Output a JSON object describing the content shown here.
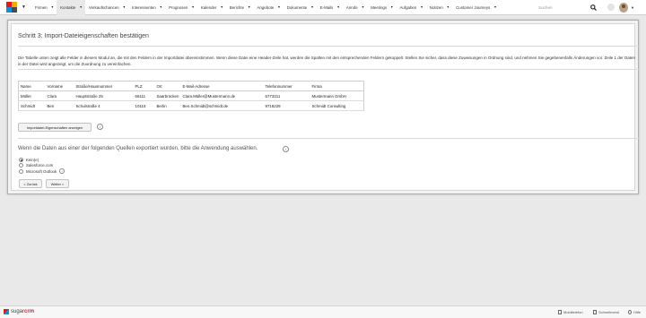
{
  "nav": {
    "items": [
      {
        "label": "Firmen",
        "active": false
      },
      {
        "label": "Kontakte",
        "active": true
      },
      {
        "label": "Verkaufschancen",
        "active": false
      },
      {
        "label": "Interessenten",
        "active": false
      },
      {
        "label": "Prognosen",
        "active": false
      },
      {
        "label": "Kalender",
        "active": false
      },
      {
        "label": "Berichte",
        "active": false
      },
      {
        "label": "Angebote",
        "active": false
      },
      {
        "label": "Dokumente",
        "active": false
      },
      {
        "label": "E-Mails",
        "active": false
      },
      {
        "label": "Anrufe",
        "active": false
      },
      {
        "label": "Meetings",
        "active": false
      },
      {
        "label": "Aufgaben",
        "active": false
      },
      {
        "label": "Notizen",
        "active": false
      },
      {
        "label": "Customer Journeys",
        "active": false
      }
    ],
    "search_placeholder": "Suchen"
  },
  "step": {
    "title": "Schritt 3: Import-Dateieigenschaften bestätigen",
    "description": "Die Tabelle unten zeigt alle Felder in diesem Modul an, die mit den Feldern in der Importdatei übereinstimmen. Wenn diese Datei eine Header-Zeile hat, werden die Spalten mit den entsprechenden Feldern gekoppelt. Stellen Sie sicher, dass diese Zuweisungen in Ordnung sind, und nehmen Sie gegebenenfalls Änderungen vor. Zeile 1 der Daten in der Datei wird angezeigt, um die Zuordnung zu vereinfachen."
  },
  "table": {
    "columns": [
      "Name",
      "Vorname",
      "Straße/Hausnummer",
      "PLZ",
      "Ort",
      "E-Mail-Adresse",
      "Telefonnummer",
      "Firma"
    ],
    "rows": [
      [
        "Müller",
        "Clara",
        "Hauptstraße 25",
        "66111",
        "Saarbrücken",
        "Clara.Müller@Mustermann.de",
        "6773311",
        "Mustermann GmbH"
      ],
      [
        "Schmidt",
        "Ben",
        "Schulstraße 4",
        "10115",
        "Berlin",
        "Ben.Schmidt@schmidt.de",
        "9718229",
        "Schmidt Consulting"
      ]
    ]
  },
  "buttons": {
    "show_props": "Importdatei-Eigenschaften anzeigen",
    "back": "< Zurück",
    "next": "Weiter >"
  },
  "source": {
    "question": "Wenn die Daten aus einer der folgenden Quellen exportiert wurden, bitte die Anwendung auswählen.",
    "options": [
      {
        "label": "Kein(e)",
        "selected": true
      },
      {
        "label": "Salesforce.com",
        "selected": false
      },
      {
        "label": "Microsoft Outlook",
        "selected": false
      }
    ]
  },
  "footer": {
    "brand_a": "sugar",
    "brand_b": "crm",
    "mobile": "Mobiltelefon",
    "shortcuts": "Schnellmenü",
    "help": "Hilfe"
  },
  "colors": {
    "accent_red": "#e61718",
    "accent_blue": "#1a8ccf"
  }
}
